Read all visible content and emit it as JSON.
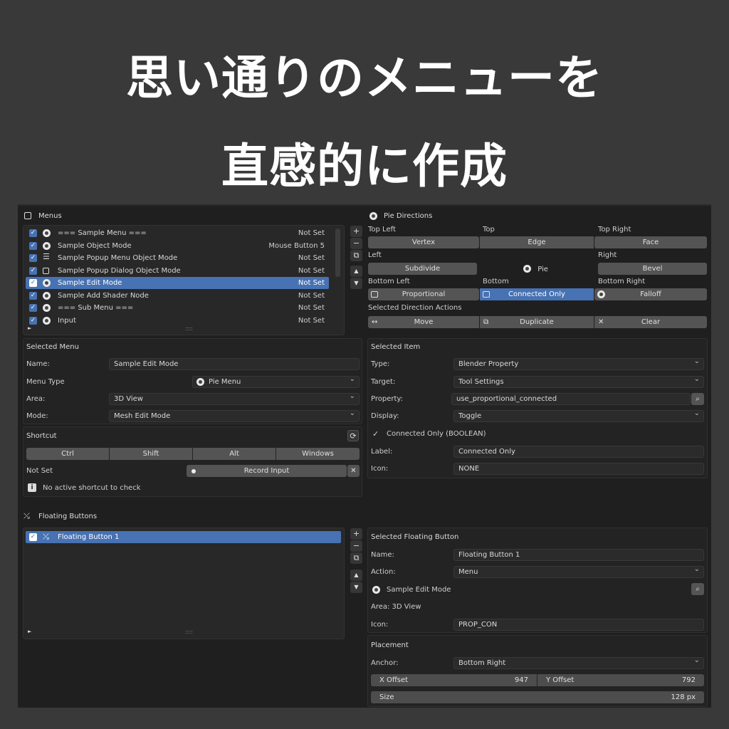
{
  "headline": {
    "line1": "思い通りのメニューを",
    "line2": "直感的に作成"
  },
  "menus": {
    "title": "Menus",
    "items": [
      {
        "label": "=== Sample Menu ===",
        "key": "Not Set",
        "icon": "pie-icon"
      },
      {
        "label": "Sample Object Mode",
        "key": "Mouse Button 5",
        "icon": "pie-icon"
      },
      {
        "label": "Sample Popup Menu Object Mode",
        "key": "Not Set",
        "icon": "list-icon"
      },
      {
        "label": "Sample Popup Dialog Object Mode",
        "key": "Not Set",
        "icon": "dialog-icon"
      },
      {
        "label": "Sample Edit Mode",
        "key": "Not Set",
        "icon": "pie-icon",
        "selected": true
      },
      {
        "label": "Sample Add Shader Node",
        "key": "Not Set",
        "icon": "pie-icon"
      },
      {
        "label": "=== Sub Menu ===",
        "key": "Not Set",
        "icon": "pie-icon"
      },
      {
        "label": "Input",
        "key": "Not Set",
        "icon": "pie-icon"
      }
    ],
    "grip": "::::"
  },
  "selected_menu": {
    "title": "Selected Menu",
    "name_label": "Name:",
    "name_value": "Sample Edit Mode",
    "type_label": "Menu Type",
    "type_value": "Pie Menu",
    "area_label": "Area:",
    "area_value": "3D View",
    "mode_label": "Mode:",
    "mode_value": "Mesh Edit Mode"
  },
  "shortcut": {
    "title": "Shortcut",
    "modifiers": [
      "Ctrl",
      "Shift",
      "Alt",
      "Windows"
    ],
    "status": "Not Set",
    "record": "Record Input",
    "info": "No active shortcut to check"
  },
  "pie": {
    "title": "Pie Directions",
    "top_left_label": "Top Left",
    "top_label": "Top",
    "top_right_label": "Top Right",
    "top_left": "Vertex",
    "top": "Edge",
    "top_right": "Face",
    "left_label": "Left",
    "right_label": "Right",
    "left": "Subdivide",
    "center": "Pie",
    "right": "Bevel",
    "bottom_left_label": "Bottom Left",
    "bottom_label": "Bottom",
    "bottom_right_label": "Bottom Right",
    "bottom_left": "Proportional",
    "bottom": "Connected Only",
    "bottom_right": "Falloff",
    "actions_label": "Selected Direction Actions",
    "move": "Move",
    "duplicate": "Duplicate",
    "clear": "Clear"
  },
  "selected_item": {
    "title": "Selected Item",
    "type_label": "Type:",
    "type_value": "Blender Property",
    "target_label": "Target:",
    "target_value": "Tool Settings",
    "property_label": "Property:",
    "property_value": "use_proportional_connected",
    "display_label": "Display:",
    "display_value": "Toggle",
    "info": "Connected Only (BOOLEAN)",
    "label_label": "Label:",
    "label_value": "Connected Only",
    "icon_label": "Icon:",
    "icon_value": "NONE"
  },
  "floating": {
    "title": "Floating Buttons",
    "items": [
      {
        "label": "Floating Button 1"
      }
    ],
    "grip": "::::"
  },
  "selected_floating": {
    "title": "Selected Floating Button",
    "name_label": "Name:",
    "name_value": "Floating Button 1",
    "action_label": "Action:",
    "action_value": "Menu",
    "menu_value": "Sample Edit Mode",
    "area_text": "Area: 3D View",
    "icon_label": "Icon:",
    "icon_value": "PROP_CON"
  },
  "placement": {
    "title": "Placement",
    "anchor_label": "Anchor:",
    "anchor_value": "Bottom Right",
    "x_label": "X Offset",
    "x_value": "947",
    "y_label": "Y Offset",
    "y_value": "792",
    "size_label": "Size",
    "size_value": "128 px"
  },
  "colors": {
    "accent": "#4772b3",
    "background": "#1f1f1f",
    "page": "#393939"
  }
}
